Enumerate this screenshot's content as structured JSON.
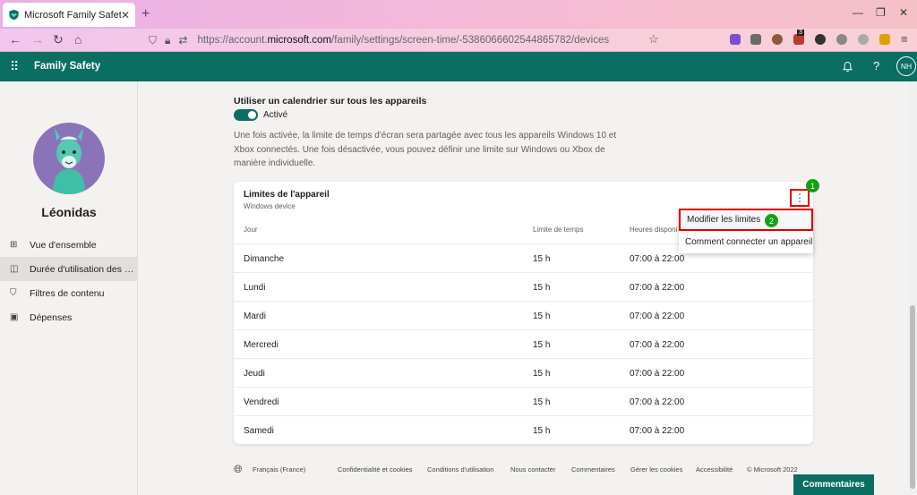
{
  "browser": {
    "tab_title": "Microsoft Family Safety",
    "tab_close": "✕",
    "new_tab": "+",
    "url_prefix": "https://account.",
    "url_domain": "microsoft.com",
    "url_path": "/family/settings/screen-time/-5386066602544865782/devices",
    "ext_badge": "3"
  },
  "app": {
    "name": "Family Safety",
    "user_initials": "NH"
  },
  "sidebar": {
    "child_name": "Léonidas",
    "items": [
      {
        "label": "Vue d'ensemble",
        "icon": "overview-icon"
      },
      {
        "label": "Durée d'utilisation des a...",
        "icon": "screen-time-icon"
      },
      {
        "label": "Filtres de contenu",
        "icon": "shield-icon"
      },
      {
        "label": "Dépenses",
        "icon": "wallet-icon"
      }
    ]
  },
  "schedule": {
    "title": "Utiliser un calendrier sur tous les appareils",
    "toggle_label": "Activé",
    "description": "Une fois activée, la limite de temps d'écran sera partagée avec tous les appareils Windows 10 et Xbox connectés. Une fois désactivée, vous pouvez définir une limite sur Windows ou Xbox de manière individuelle."
  },
  "device_card": {
    "title": "Limites de l'appareil",
    "subtitle": "Windows device",
    "columns": [
      "Jour",
      "Limite de temps",
      "Heures disponi"
    ],
    "rows": [
      {
        "day": "Dimanche",
        "limit": "15 h",
        "hours": "07:00 à 22:00"
      },
      {
        "day": "Lundi",
        "limit": "15 h",
        "hours": "07:00 à 22:00"
      },
      {
        "day": "Mardi",
        "limit": "15 h",
        "hours": "07:00 à 22:00"
      },
      {
        "day": "Mercredi",
        "limit": "15 h",
        "hours": "07:00 à 22:00"
      },
      {
        "day": "Jeudi",
        "limit": "15 h",
        "hours": "07:00 à 22:00"
      },
      {
        "day": "Vendredi",
        "limit": "15 h",
        "hours": "07:00 à 22:00"
      },
      {
        "day": "Samedi",
        "limit": "15 h",
        "hours": "07:00 à 22:00"
      }
    ]
  },
  "context_menu": {
    "items": [
      "Modifier les limites",
      "Comment connecter un appareil"
    ]
  },
  "annotations": {
    "step1": "1",
    "step2": "2"
  },
  "footer": {
    "language": "Français (France)",
    "links": [
      "Confidentialité et cookies",
      "Conditions d'utilisation",
      "Nous contacter",
      "Commentaires",
      "Gérer les cookies",
      "Accessibilité",
      "© Microsoft 2022"
    ]
  },
  "feedback_button": "Commentaires",
  "colors": {
    "brand": "#0b6e62",
    "highlight": "#e00000",
    "badge": "#12a311"
  }
}
